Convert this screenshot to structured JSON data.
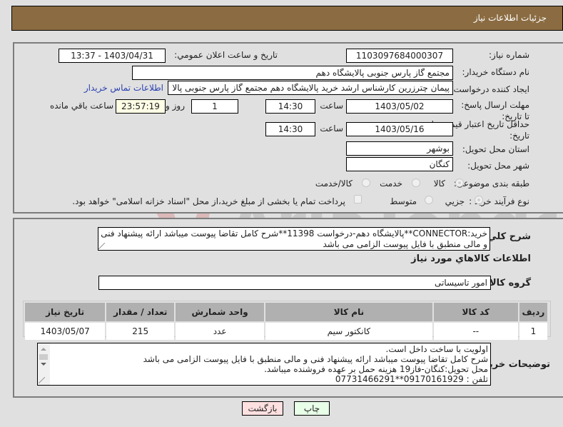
{
  "header": {
    "title": "جزئیات اطلاعات نیاز"
  },
  "form": {
    "need_number": {
      "label": "شماره نیاز:",
      "value": "1103097684000307"
    },
    "announce_datetime": {
      "label": "تاریخ و ساعت اعلان عمومي:",
      "value": "1403/04/31 - 13:37"
    },
    "buyer_org": {
      "label": "نام دستگاه خريدار:",
      "value": "مجتمع گاز پارس جنوبی  پالایشگاه دهم"
    },
    "requester": {
      "label": "ايجاد کننده درخواست:",
      "value": "پیمان چترزرین کارشناس ارشد خرید پالایشگاه دهم مجتمع گاز پارس جنوبی  پالا",
      "contact_link": "اطلاعات تماس خریدار"
    },
    "reply_deadline": {
      "label": "مهلت ارسال پاسخ: تا تاريخ:",
      "date": "1403/05/02",
      "time_label": "ساعت",
      "time": "14:30",
      "days": "1",
      "days_label": "روز و",
      "remaining": "23:57:19",
      "remaining_label": "ساعت باقي مانده"
    },
    "price_validity": {
      "label": "حداقل تاريخ اعتبار قيمت: تا تاريخ:",
      "date": "1403/05/16",
      "time_label": "ساعت",
      "time": "14:30"
    },
    "province": {
      "label": "استان محل تحويل:",
      "value": "بوشهر"
    },
    "city": {
      "label": "شهر محل تحويل:",
      "value": "کنگان"
    },
    "category": {
      "label": "طبقه بندی موضوعی:",
      "options": [
        "کالا",
        "خدمت",
        "کالا/خدمت"
      ],
      "selected": "کالا"
    },
    "process": {
      "label": "نوع فرآيند خريد :",
      "options": [
        "جزیي",
        "متوسط"
      ],
      "selected": "جزیي",
      "treasury_note": "پرداخت تمام يا بخشی از مبلغ خريد،از محل \"اسناد خزانه اسلامی\" خواهد بود."
    }
  },
  "description": {
    "label": "شرح کلي نياز:",
    "value": "خرید:CONNECTOR**پالایشگاه دهم-درخواست 11398**شرح کامل تقاضا پیوست میباشد ارائه پیشنهاد فنی و مالی منطبق با فایل پیوست الزامی می باشد"
  },
  "goods": {
    "section_title": "اطلاعات کالاهاي مورد نياز",
    "group_label": "گروه کالا:",
    "group_value": "امور تاسیساتی",
    "table": {
      "headers": [
        "رديف",
        "کد کالا",
        "نام کالا",
        "واحد شمارش",
        "تعداد / مقدار",
        "تاريخ نياز"
      ],
      "rows": [
        [
          "1",
          "--",
          "کانکتور سیم",
          "عدد",
          "215",
          "1403/05/07"
        ]
      ]
    }
  },
  "buyer_notes": {
    "label": "توضيحات خريدار:",
    "lines": [
      "اولویت با ساخت داخل است.",
      "شرح کامل تقاضا پیوست میباشد ارائه پیشنهاد فنی و مالی منطبق با فایل پیوست الزامی می باشد",
      "محل تحویل:کنگان-فاز19 هزینه حمل بر عهده فروشنده میباشد.",
      "تلفن : 09170161929**07731466291"
    ]
  },
  "buttons": {
    "print": "چاپ",
    "back": "بازگشت"
  },
  "watermark": {
    "text": "AriaTender.neT"
  }
}
